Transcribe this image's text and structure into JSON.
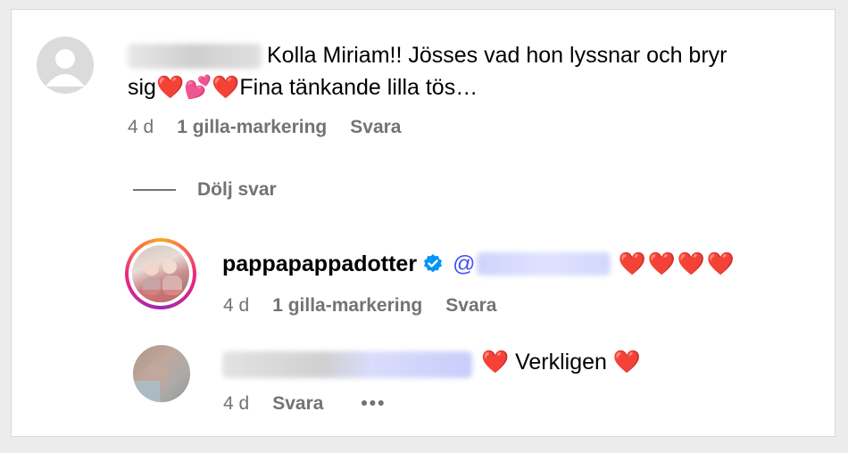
{
  "comment1": {
    "text_line1": "Kolla Miriam!! Jösses vad hon lyssnar och bryr",
    "text_line2_pre": "sig",
    "emoji_a": "❤️",
    "emoji_b": "💕",
    "emoji_c": "❤️",
    "text_line2_post": "Fina tänkande lilla tös…",
    "time": "4 d",
    "likes": "1 gilla-markering",
    "reply": "Svara"
  },
  "hide_replies": "Dölj svar",
  "reply1": {
    "username": "pappapappadotter",
    "mention_at": "@",
    "hearts": "❤️❤️❤️❤️",
    "time": "4 d",
    "likes": "1 gilla-markering",
    "reply": "Svara"
  },
  "reply2": {
    "heart_pre": "❤️",
    "text": "Verkligen",
    "heart_post": "❤️",
    "time": "4 d",
    "reply": "Svara",
    "more": "•••"
  },
  "icons": [
    "default-avatar-icon",
    "verified-badge-icon",
    "more-options-icon"
  ],
  "colors": {
    "meta_gray": "#737373",
    "verified_blue": "#0095f6",
    "mention_blue": "#4150f7",
    "heart_red": "#ee1d2f"
  }
}
